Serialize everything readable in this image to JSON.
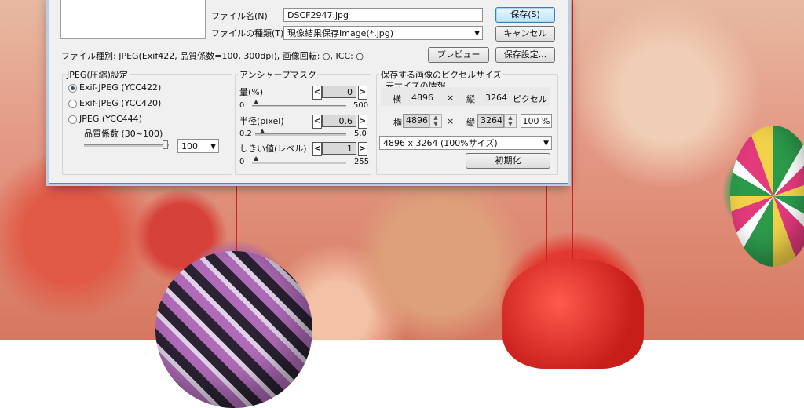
{
  "save_dialog": {
    "filename_label": "ファイル名(N)",
    "filename_value": "DSCF2947.jpg",
    "filetype_label": "ファイルの種類(T)",
    "filetype_value": "現像結果保存Image(*.jpg)",
    "save_button": "保存(S)",
    "cancel_button": "キャンセル",
    "file_info": "ファイル種別: JPEG(Exif422, 品質係数=100, 300dpi), 画像回転: ○, ICC: ○",
    "preview_button": "プレビュー",
    "save_settings_button": "保存設定..."
  },
  "jpeg_settings": {
    "title": "JPEG(圧縮)設定",
    "options": [
      "Exif-JPEG (YCC422)",
      "Exif-JPEG (YCC420)",
      "JPEG (YCC444)"
    ],
    "selected_index": 0,
    "quality_label": "品質係数 (30~100)",
    "quality_value": "100"
  },
  "unsharp_mask": {
    "title": "アンシャープマスク",
    "amount_label": "量(%)",
    "amount_value": "0",
    "amount_min": "0",
    "amount_max": "500",
    "radius_label": "半径(pixel)",
    "radius_value": "0.6",
    "radius_min": "0.2",
    "radius_max": "5.0",
    "threshold_label": "しきい値(レベル)",
    "threshold_value": "1",
    "threshold_min": "0",
    "threshold_max": "255"
  },
  "pixel_size": {
    "title": "保存する画像のピクセルサイズ",
    "original_title": "元サイズの情報",
    "width_label": "横",
    "original_width": "4896",
    "times": "×",
    "height_label": "縦",
    "original_height": "3264",
    "unit": "ピクセル",
    "width_value": "4896",
    "height_value": "3264",
    "percent": "100 %",
    "preset_value": "4896 x 3264 (100%サイズ)",
    "reset_button": "初期化"
  }
}
